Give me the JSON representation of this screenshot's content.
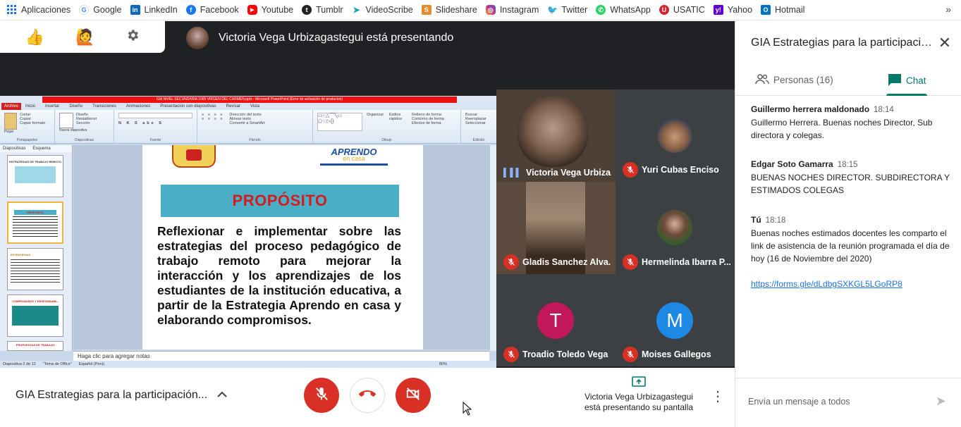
{
  "bookmarks": [
    {
      "label": "Aplicaciones",
      "icon": "apps-grid-icon",
      "color": "#1a73e8"
    },
    {
      "label": "Google",
      "icon": "google-icon",
      "color": "#4285f4"
    },
    {
      "label": "LinkedIn",
      "icon": "linkedin-icon",
      "color": "#0a66c2"
    },
    {
      "label": "Facebook",
      "icon": "facebook-icon",
      "color": "#1877f2"
    },
    {
      "label": "Youtube",
      "icon": "youtube-icon",
      "color": "#ff0000"
    },
    {
      "label": "Tumblr",
      "icon": "tumblr-icon",
      "color": "#222222"
    },
    {
      "label": "VideoScribe",
      "icon": "videoscribe-icon",
      "color": "#1aa6b7"
    },
    {
      "label": "Slideshare",
      "icon": "slideshare-icon",
      "color": "#e68a2e"
    },
    {
      "label": "Instagram",
      "icon": "instagram-icon",
      "color": "#c13584"
    },
    {
      "label": "Twitter",
      "icon": "twitter-icon",
      "color": "#1da1f2"
    },
    {
      "label": "WhatsApp",
      "icon": "whatsapp-icon",
      "color": "#25d366"
    },
    {
      "label": "USATIC",
      "icon": "usatic-icon",
      "color": "#d9232e"
    },
    {
      "label": "Yahoo",
      "icon": "yahoo-icon",
      "color": "#6001d2"
    },
    {
      "label": "Hotmail",
      "icon": "outlook-icon",
      "color": "#0072c6"
    }
  ],
  "bookmarks_more": "»",
  "presenter_banner": "Victoria Vega Urbizagastegui está presentando",
  "ppt": {
    "window_title": "GIA NIVEL SECUNDARIA 1065 VIRGEN DEL CARMEN.pptx - Microsoft PowerPoint (Error de activación de productos)",
    "tabs": [
      "Archivo",
      "Inicio",
      "Insertar",
      "Diseño",
      "Transiciones",
      "Animaciones",
      "Presentación con diapositivas",
      "Revisar",
      "Vista"
    ],
    "ribbon_groups": [
      "Portapapeles",
      "Diapositivas",
      "Fuente",
      "Párrafo",
      "Dibujo",
      "Edición"
    ],
    "ribbon_items": {
      "clipboard": [
        "Pegar",
        "Cortar",
        "Copiar",
        "Copiar formato"
      ],
      "slides": [
        "Nueva diapositiva",
        "Diseño",
        "Restablecer",
        "Sección"
      ],
      "drawing": [
        "Organizar",
        "Estilos rápidos",
        "Relleno de forma",
        "Contorno de forma",
        "Efectos de forma"
      ],
      "edit": [
        "Buscar",
        "Reemplazar",
        "Seleccionar"
      ],
      "paragraph": [
        "Dirección del texto",
        "Alinear texto",
        "Convertir a SmartArt"
      ]
    },
    "left_tabs": [
      "Diapositivas",
      "Esquema"
    ],
    "thumb_numbers": [
      "1",
      "2",
      "3",
      "4",
      "5"
    ],
    "thumb_titles": [
      "ESTRATEGIAS DE TRABAJO REMOTO",
      "PROPÓSITO",
      "ESTRATEGIAS",
      "COMPROMISOS Y RESPONSABIL.",
      "PROPUESTAS DE TRABAJO"
    ],
    "slide_brand_top": "APRENDO",
    "slide_brand_bottom": "en casa",
    "slide_banner": "PROPÓSITO",
    "slide_text": "Reflexionar e implementar sobre las estrategias del proceso pedagógico de trabajo remoto para mejorar la interacción y los aprendizajes de los estudiantes de la institución educativa, a partir de la Estrategia Aprendo en casa y elaborando compromisos.",
    "notes_placeholder": "Haga clic para agregar notas",
    "status_slide": "Diapositiva 2 de 12",
    "status_theme": "\"Tema de Office\"",
    "status_lang": "Español (Perú)",
    "status_zoom": "80%"
  },
  "participants": [
    {
      "name": "Victoria Vega Urbiza...",
      "muted": false
    },
    {
      "name": "Yuri Cubas Enciso",
      "muted": true
    },
    {
      "name": "Gladis Sanchez Alva...",
      "muted": true
    },
    {
      "name": "Hermelinda Ibarra P...",
      "muted": true
    },
    {
      "name": "Troadio Toledo Vega",
      "muted": true,
      "initial": "T",
      "color": "#c2185b"
    },
    {
      "name": "Moises Gallegos",
      "muted": true,
      "initial": "M",
      "color": "#1e88e5"
    }
  ],
  "controls": {
    "meeting_title": "GIA Estrategias para la participación...",
    "presenting_line1": "Victoria Vega Urbizagastegui",
    "presenting_line2": "está presentando su pantalla",
    "mic_color": "#d93025"
  },
  "sidebar": {
    "title": "GIA Estrategias para la participació...",
    "tab_people": "Personas (16)",
    "tab_chat": "Chat",
    "messages": [
      {
        "sender": "Guillermo herrera maldonado",
        "time": "18:14",
        "text": "Guillermo Herrera. Buenas noches Director,  Sub directora y colegas."
      },
      {
        "sender": "Edgar Soto Gamarra",
        "time": "18:15",
        "text": "BUENAS NOCHES DIRECTOR. SUBDIRECTORA  Y ESTIMADOS COLEGAS"
      },
      {
        "sender": "Tú",
        "time": "18:18",
        "text": "Buenas noches estimados docentes les comparto el link de asistencia de la reunión programada el día de hoy (16 de Noviembre del 2020)",
        "link": "https://forms.gle/dLdbgSXKGL5LGoRP8"
      }
    ],
    "compose_placeholder": "Envía un mensaje a todos",
    "accent": "#00796b"
  }
}
